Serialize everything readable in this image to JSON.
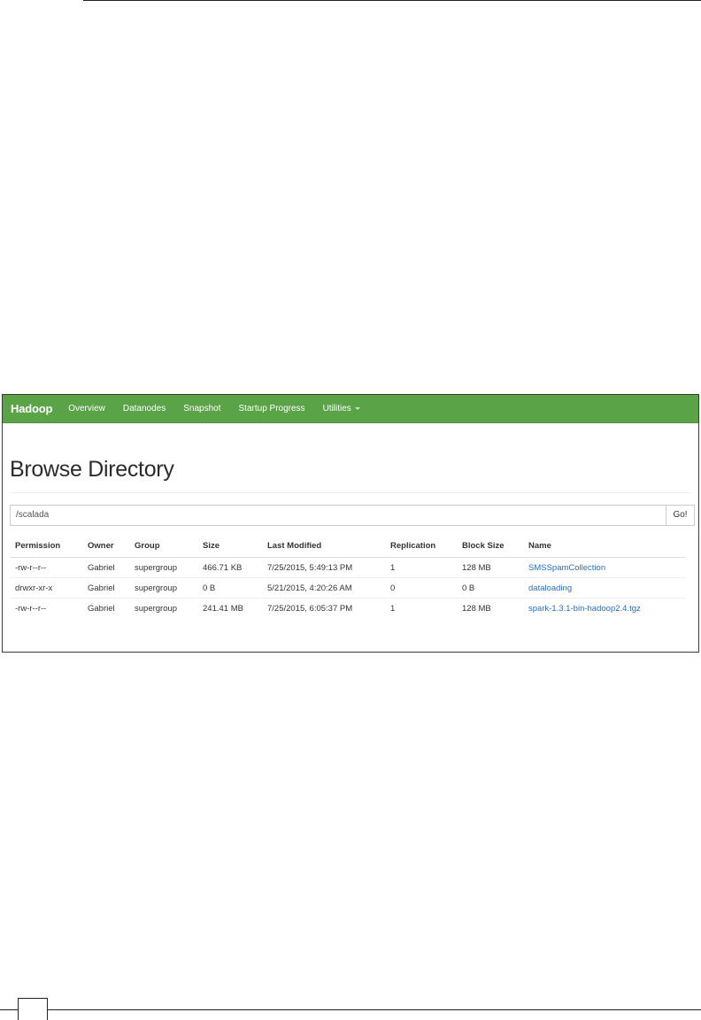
{
  "navbar": {
    "brand": "Hadoop",
    "items": [
      {
        "label": "Overview"
      },
      {
        "label": "Datanodes"
      },
      {
        "label": "Snapshot"
      },
      {
        "label": "Startup Progress"
      },
      {
        "label": "Utilities"
      }
    ]
  },
  "page": {
    "title": "Browse Directory"
  },
  "path_bar": {
    "value": "/scalada",
    "go_label": "Go!"
  },
  "table": {
    "columns": [
      "Permission",
      "Owner",
      "Group",
      "Size",
      "Last Modified",
      "Replication",
      "Block Size",
      "Name"
    ],
    "rows": [
      {
        "permission": "-rw-r--r--",
        "owner": "Gabriel",
        "group": "supergroup",
        "size": "466.71 KB",
        "modified": "7/25/2015, 5:49:13 PM",
        "replication": "1",
        "block_size": "128 MB",
        "name": "SMSSpamCollection"
      },
      {
        "permission": "drwxr-xr-x",
        "owner": "Gabriel",
        "group": "supergroup",
        "size": "0 B",
        "modified": "5/21/2015, 4:20:26 AM",
        "replication": "0",
        "block_size": "0 B",
        "name": "dataloading"
      },
      {
        "permission": "-rw-r--r--",
        "owner": "Gabriel",
        "group": "supergroup",
        "size": "241.41 MB",
        "modified": "7/25/2015, 6:05:37 PM",
        "replication": "1",
        "block_size": "128 MB",
        "name": "spark-1.3.1-bin-hadoop2.4.tgz"
      }
    ]
  },
  "colors": {
    "navbar": "#5aa346",
    "link": "#2a6ebb"
  },
  "icons": {
    "utilities_dropdown": "chevron-down-icon"
  }
}
